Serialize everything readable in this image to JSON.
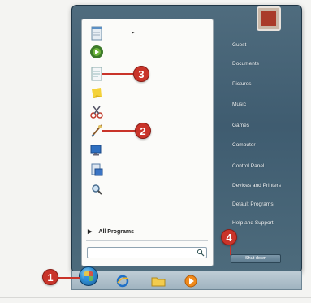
{
  "start_menu": {
    "programs_pane": {
      "items": [
        {
          "icon": "notepad-icon"
        },
        {
          "icon": "media-center-icon"
        },
        {
          "icon": "document-icon"
        },
        {
          "icon": "sticky-notes-icon"
        },
        {
          "icon": "snipping-tool-icon"
        },
        {
          "icon": "paint-icon"
        },
        {
          "icon": "remote-desktop-icon"
        },
        {
          "icon": "xps-viewer-icon"
        },
        {
          "icon": "magnifier-icon"
        }
      ],
      "all_programs_label": "All Programs",
      "search_placeholder": ""
    },
    "right_pane": {
      "items": [
        {
          "label": "Guest"
        },
        {
          "label": "Documents"
        },
        {
          "label": "Pictures"
        },
        {
          "label": "Music"
        },
        {
          "label": "Games"
        },
        {
          "label": "Computer"
        },
        {
          "label": "Control Panel"
        },
        {
          "label": "Devices and Printers"
        },
        {
          "label": "Default Programs"
        },
        {
          "label": "Help and Support"
        }
      ],
      "shutdown_label": "Shut down"
    }
  },
  "callouts": [
    "1",
    "2",
    "3",
    "4"
  ],
  "taskbar": {
    "icons": [
      "start-orb-icon",
      "internet-explorer-icon",
      "explorer-folder-icon",
      "media-player-icon"
    ]
  },
  "colors": {
    "callout": "#c9342a",
    "menu_dark": "#4f6c7e",
    "taskbar": "#bfcdd6"
  }
}
